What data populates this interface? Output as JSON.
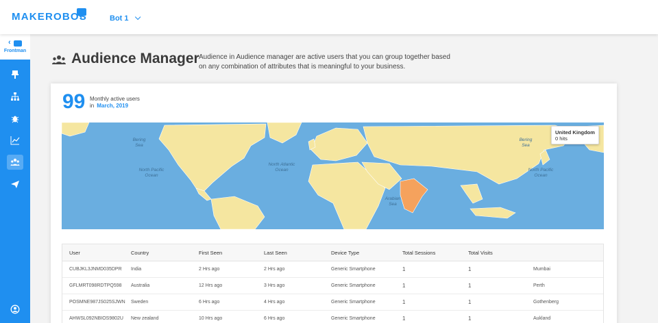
{
  "header": {
    "logo": "MAKEROBOS",
    "bot_selector": "Bot 1"
  },
  "sidebar": {
    "back_label": "Frontman",
    "items": [
      {
        "icon": "brush-icon"
      },
      {
        "icon": "sitemap-icon"
      },
      {
        "icon": "bug-icon"
      },
      {
        "icon": "line-chart-icon"
      },
      {
        "icon": "audience-icon",
        "active": true
      },
      {
        "icon": "send-icon"
      },
      {
        "icon": "user-account-icon"
      }
    ]
  },
  "page": {
    "title": "Audience Manager",
    "description": "Audience in Audience manager are active users that you can group together based on any combination of attributes that is meaningful to your business."
  },
  "stats": {
    "count": "99",
    "label": "Monthly active users",
    "in_label": "in",
    "period": "March, 2019"
  },
  "map": {
    "tooltip_title": "United Kingdom",
    "tooltip_value": "0 hits",
    "highlight_color": "#f5a25d",
    "land_color": "#f5e6a0",
    "ocean_color": "#6aaee0",
    "labels": {
      "north_pacific_left": "North Pacific Ocean",
      "north_atlantic": "North Atlantic Ocean",
      "north_pacific_right": "North Pacific Ocean",
      "arabian_sea": "Arabian Sea",
      "bering_left": "Bering Sea",
      "bering_right": "Bering Sea"
    }
  },
  "table": {
    "headers": [
      "User",
      "Country",
      "First Seen",
      "Last Seen",
      "Device Type",
      "Total Sessions",
      "Total Visits",
      ""
    ],
    "rows": [
      [
        "CUBJKL3JNMD035DPR",
        "India",
        "2 Hrs ago",
        "2 Hrs ago",
        "Generic Smartphone",
        "1",
        "1",
        "Mumbai"
      ],
      [
        "GFLMRT098RDTPQ598",
        "Australia",
        "12 Hrs ago",
        "3 Hrs ago",
        "Generic Smartphone",
        "1",
        "1",
        "Perth"
      ],
      [
        "POSMNE987JS025SJWN",
        "Sweden",
        "6 Hrs ago",
        "4 Hrs ago",
        "Generic Smartphone",
        "1",
        "1",
        "Gothenberg"
      ],
      [
        "AHWSL092NBIOS9802U",
        "New zealand",
        "10 Hrs ago",
        "6 Hrs ago",
        "Generic Smartphone",
        "1",
        "1",
        "Aukland"
      ]
    ]
  }
}
